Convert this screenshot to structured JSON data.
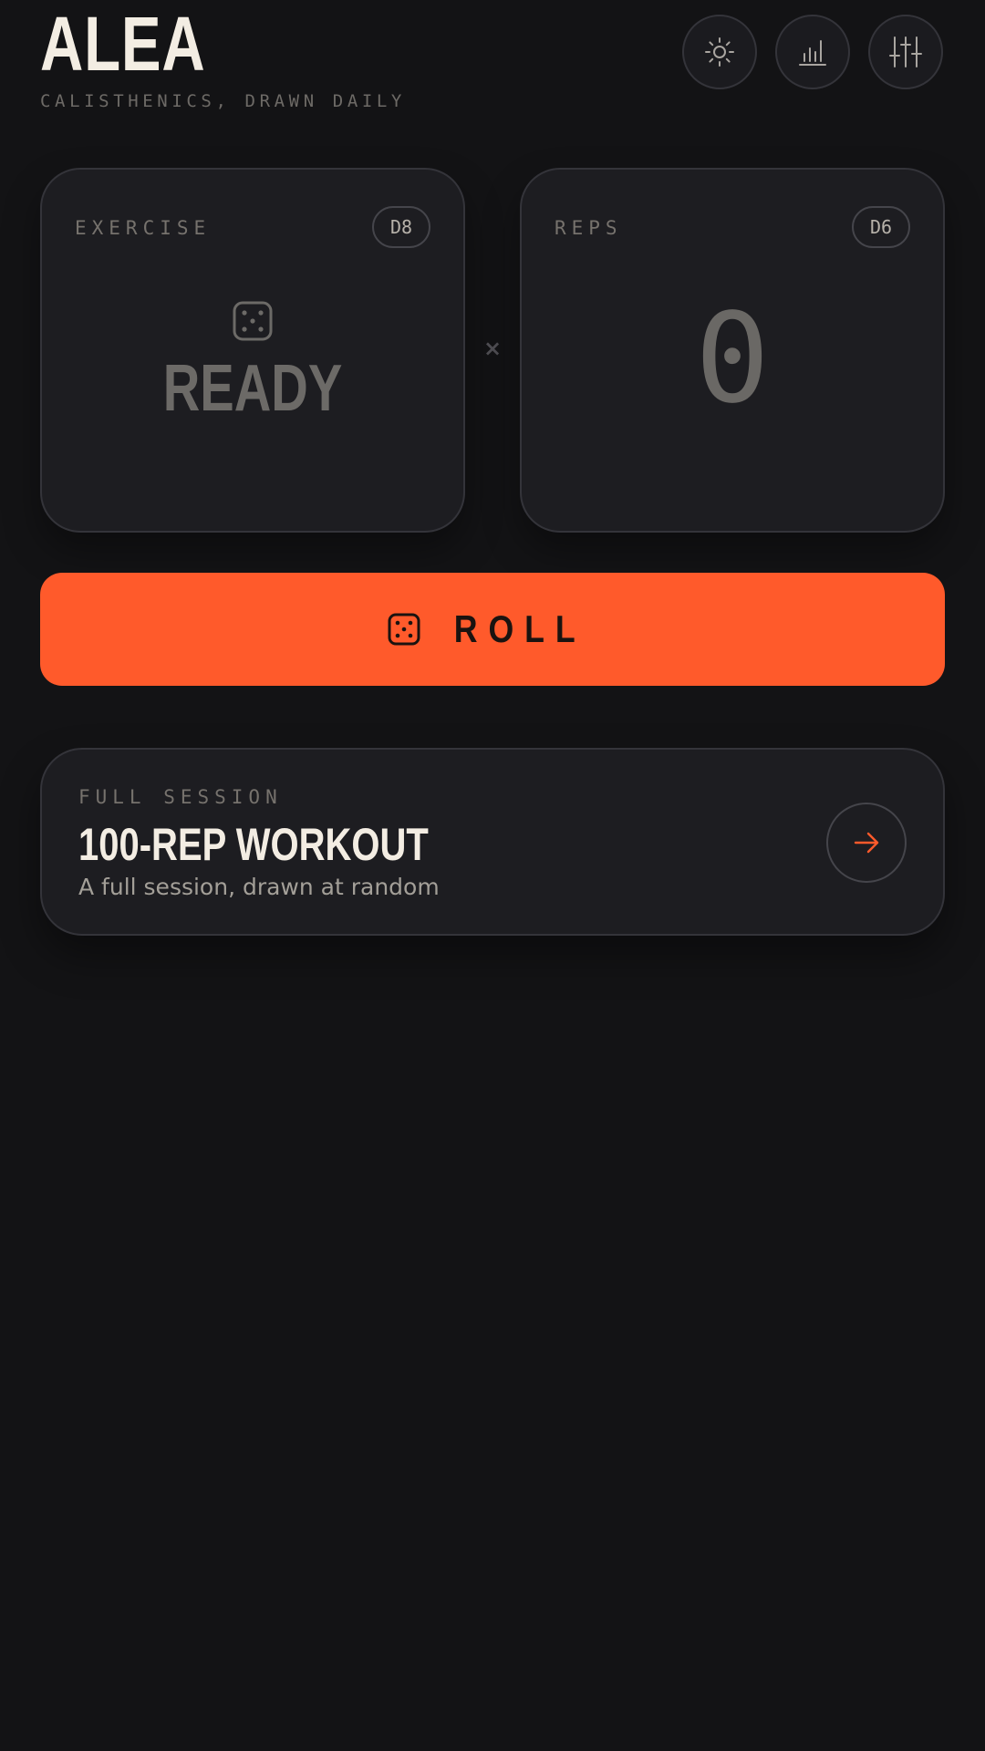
{
  "header": {
    "brand": "ALEA",
    "tagline": "CALISTHENICS, DRAWN DAILY",
    "actions": [
      {
        "icon": "sun-icon",
        "name": "theme-toggle-button"
      },
      {
        "icon": "bar-chart-icon",
        "name": "stats-button"
      },
      {
        "icon": "sliders-icon",
        "name": "settings-button"
      }
    ]
  },
  "exercise_card": {
    "label": "EXERCISE",
    "die": "D8",
    "value": "READY",
    "icon": "dice-five-icon"
  },
  "multiplier": "×",
  "reps_card": {
    "label": "REPS",
    "die": "D6",
    "value": "0"
  },
  "roll_button": {
    "label": "ROLL",
    "icon": "dice-five-icon"
  },
  "session": {
    "eyebrow": "FULL SESSION",
    "title": "100-REP WORKOUT",
    "subtitle": "A full session, drawn at random",
    "icon": "arrow-right-icon"
  },
  "colors": {
    "background": "#131315",
    "card": "#1d1d21",
    "accent": "#ff5a2b",
    "text_primary": "#f3ede3",
    "text_muted": "#76726d"
  }
}
